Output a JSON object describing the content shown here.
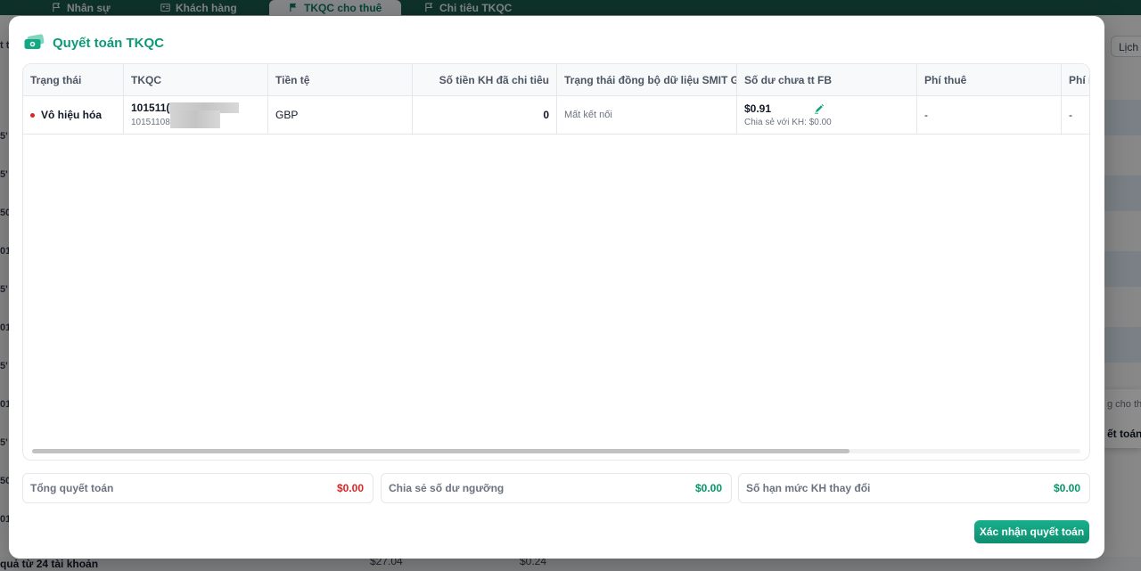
{
  "background": {
    "tabs": [
      {
        "label": "Nhân sự"
      },
      {
        "label": "Khách hàng"
      },
      {
        "label": "TKQC cho thuê"
      },
      {
        "label": "Chi tiêu TKQC"
      }
    ],
    "history_button_label": "Lịch s",
    "popover": {
      "line1": "g cho th",
      "line2": "ết toán T"
    },
    "footer": {
      "summary_label": "quả từ 24 tài khoản",
      "total_1": "$27.04",
      "total_2": "$0.24"
    },
    "left_marks": [
      "t t",
      "5'",
      "5'",
      "50",
      "01",
      "5'",
      "01",
      "5'",
      "01",
      "5'",
      "50",
      "01"
    ]
  },
  "modal": {
    "title": "Quyết toán TKQC",
    "columns": {
      "status": "Trạng thái",
      "account": "TKQC",
      "currency": "Tiền tệ",
      "spent": "Số tiền KH đã chi tiêu",
      "sync": "Trạng thái đồng bộ dữ liệu SMIT Gat",
      "balance": "Số dư chưa tt FB",
      "rent_fee": "Phí thuê",
      "other_fee": "Phí n"
    },
    "rows": [
      {
        "status": "Vô hiệu hóa",
        "account_id": "101511(",
        "account_sub": "10151108",
        "currency": "GBP",
        "spent": "0",
        "sync": "Mất kết nối",
        "balance": "$0.91",
        "shared": "Chia sẻ với KH: $0.00",
        "rent_fee": "-",
        "other_fee": "-"
      }
    ],
    "summary": {
      "total_label": "Tổng quyết toán",
      "total_value": "$0.00",
      "share_label": "Chia sẻ số dư ngưỡng",
      "share_value": "$0.00",
      "limit_label": "Số hạn mức KH thay đổi",
      "limit_value": "$0.00"
    },
    "confirm_label": "Xác nhận quyết toán"
  },
  "colors": {
    "brand_green": "#0d9a78",
    "status_red": "#dc2626",
    "tab_bar": "#1a5a4d"
  },
  "horizontal_scroll_fraction": 0.78
}
